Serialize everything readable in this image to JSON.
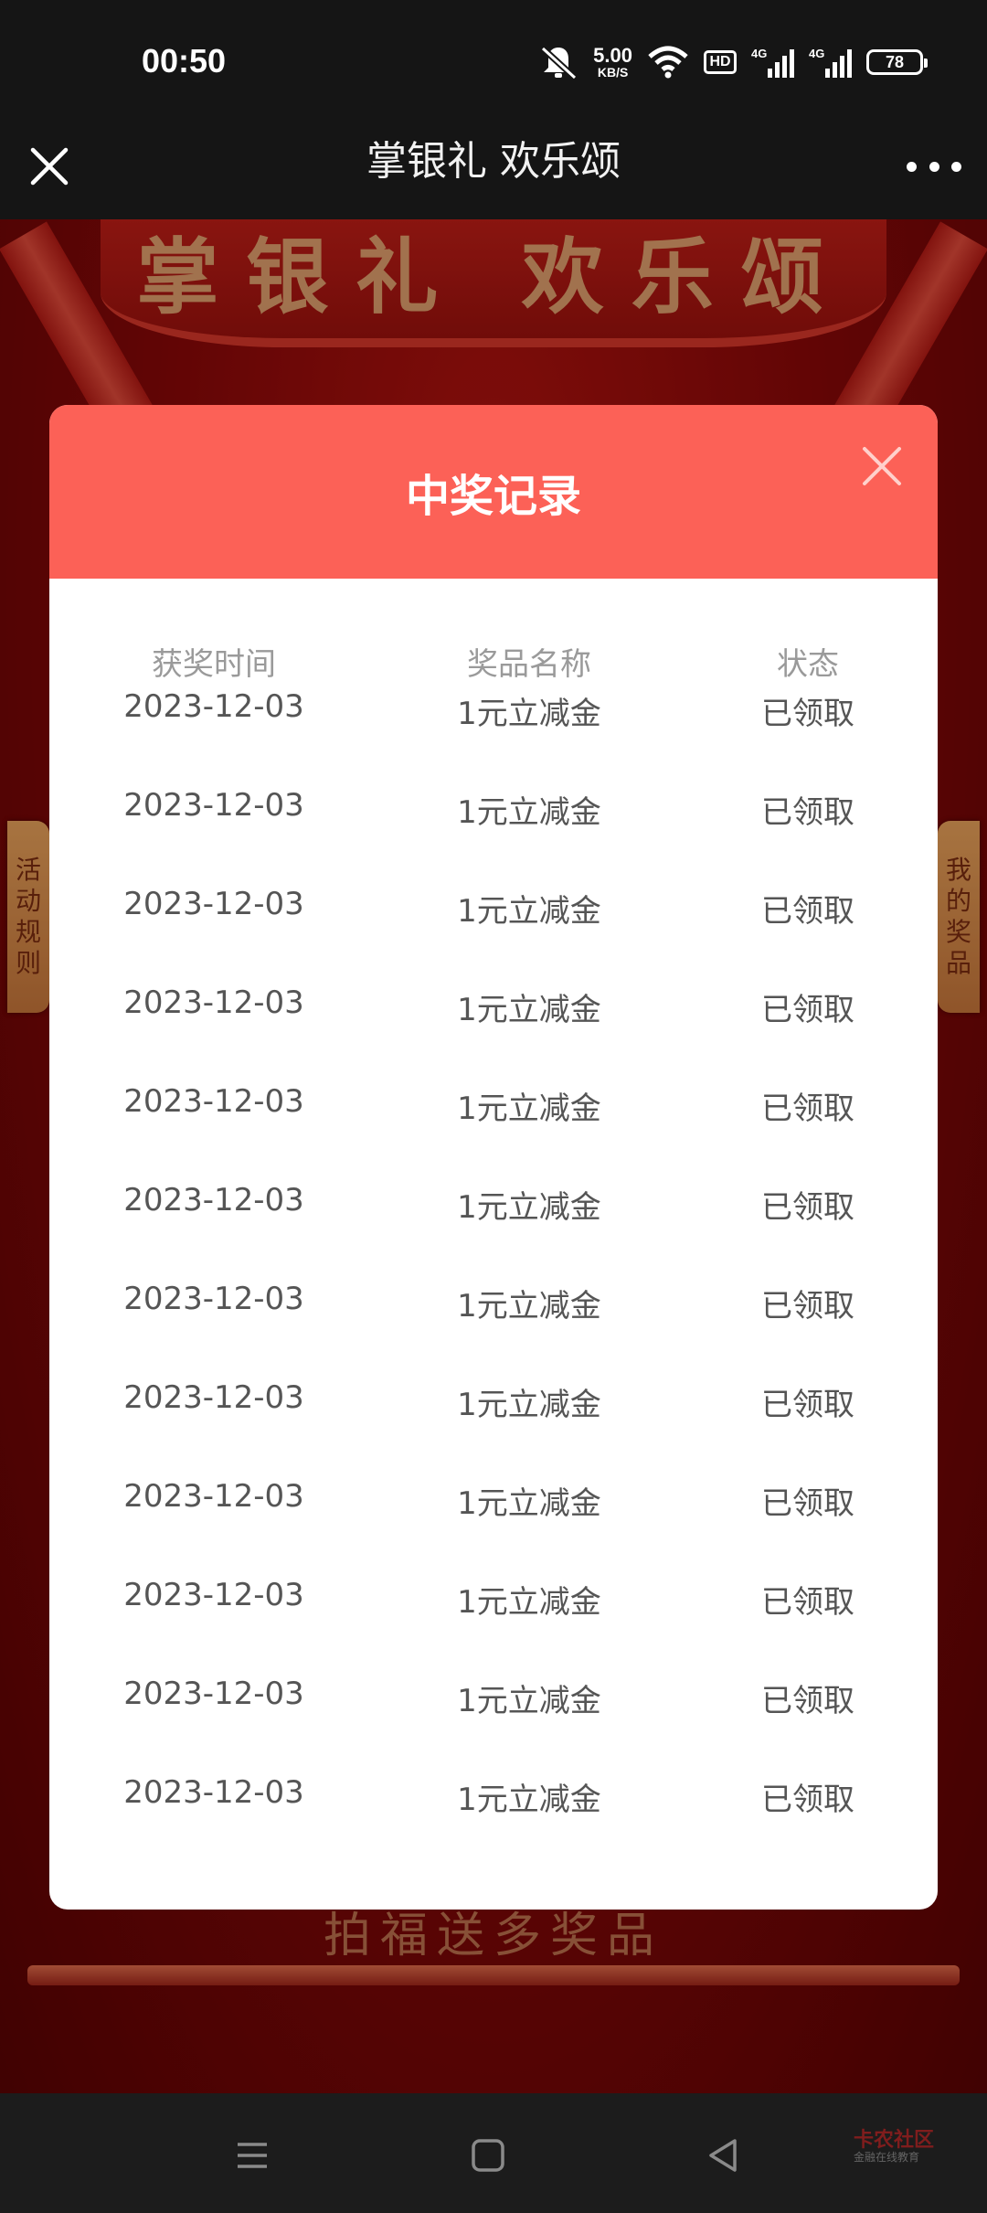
{
  "status_bar": {
    "time": "00:50",
    "net_speed_value": "5.00",
    "net_speed_unit": "KB/S",
    "hd_label": "HD",
    "signal_1_label": "4G",
    "signal_2_label": "4G",
    "battery_level": "78"
  },
  "title_bar": {
    "title": "掌银礼 欢乐颂"
  },
  "background": {
    "banner_text": "掌银礼 欢乐颂",
    "left_tab_chars": [
      "活",
      "动",
      "规",
      "则"
    ],
    "right_tab_chars": [
      "我",
      "的",
      "奖",
      "品"
    ],
    "bottom_text": "拍福送多奖品"
  },
  "modal": {
    "title": "中奖记录",
    "headers": {
      "time": "获奖时间",
      "prize": "奖品名称",
      "status": "状态"
    },
    "rows": [
      {
        "date": "2023-12-03",
        "prize": "1元立减金",
        "status": "已领取"
      },
      {
        "date": "2023-12-03",
        "prize": "1元立减金",
        "status": "已领取"
      },
      {
        "date": "2023-12-03",
        "prize": "1元立减金",
        "status": "已领取"
      },
      {
        "date": "2023-12-03",
        "prize": "1元立减金",
        "status": "已领取"
      },
      {
        "date": "2023-12-03",
        "prize": "1元立减金",
        "status": "已领取"
      },
      {
        "date": "2023-12-03",
        "prize": "1元立减金",
        "status": "已领取"
      },
      {
        "date": "2023-12-03",
        "prize": "1元立减金",
        "status": "已领取"
      },
      {
        "date": "2023-12-03",
        "prize": "1元立减金",
        "status": "已领取"
      },
      {
        "date": "2023-12-03",
        "prize": "1元立减金",
        "status": "已领取"
      },
      {
        "date": "2023-12-03",
        "prize": "1元立减金",
        "status": "已领取"
      },
      {
        "date": "2023-12-03",
        "prize": "1元立减金",
        "status": "已领取"
      },
      {
        "date": "2023-12-03",
        "prize": "1元立减金",
        "status": "已领取"
      }
    ]
  },
  "watermark": {
    "text": "卡农社区",
    "sub": "金融在线教育"
  },
  "colors": {
    "modal_header": "#fc6157",
    "page_red": "#8a0808",
    "text_gray": "#555555",
    "header_gray": "#9a9a9a"
  },
  "icons": {
    "title_close": "close-icon",
    "title_more": "more-icon",
    "modal_close": "close-icon",
    "nav_menu": "menu-icon",
    "nav_home": "home-icon",
    "nav_back": "back-icon"
  }
}
